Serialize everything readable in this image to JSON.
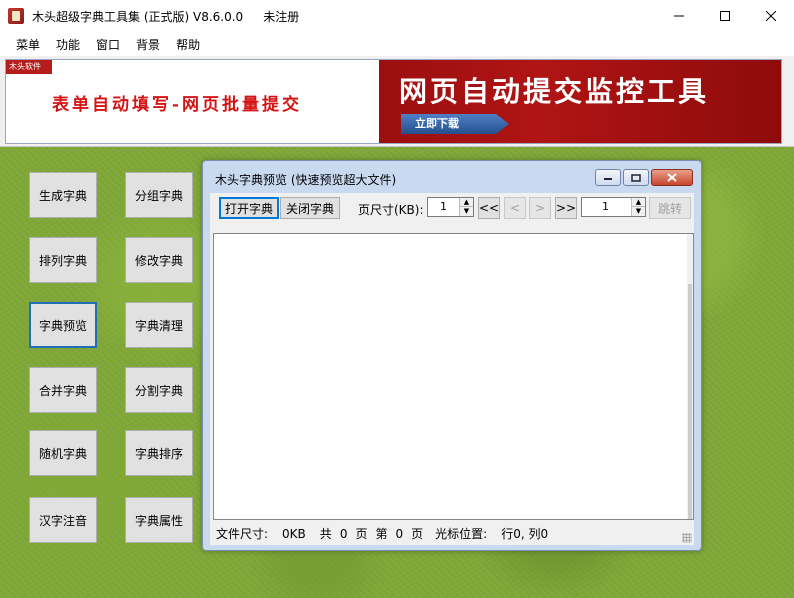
{
  "window": {
    "title": "木头超级字典工具集 (正式版) V8.6.0.0",
    "registration": "未注册",
    "minimize_icon": "minimize-icon",
    "maximize_icon": "maximize-icon",
    "close_icon": "close-icon"
  },
  "menu": [
    "菜单",
    "功能",
    "窗口",
    "背景",
    "帮助"
  ],
  "banner": {
    "logo_text": "木头软件",
    "left_text": "表单自动填写-网页批量提交",
    "right_title": "网页自动提交监控工具",
    "download_label": "立即下载"
  },
  "sidebar": {
    "buttons": [
      "生成字典",
      "分组字典",
      "排列字典",
      "修改字典",
      "字典预览",
      "字典清理",
      "合并字典",
      "分割字典",
      "随机字典",
      "字典排序",
      "汉字注音",
      "字典属性"
    ],
    "focused": "字典预览"
  },
  "preview": {
    "title": "木头字典预览 (快速预览超大文件)",
    "open_btn": "打开字典",
    "close_btn": "关闭字典",
    "page_size_label": "页尺寸(KB):",
    "page_size_value": "1",
    "nav_first": "<<",
    "nav_prev": "<",
    "nav_next": ">",
    "nav_last": ">>",
    "page_value": "1",
    "jump_btn": "跳转",
    "status": {
      "file_size_label": "文件尺寸:",
      "file_size_value": "0KB",
      "total_label": "共",
      "total_value": "0",
      "page_unit": "页",
      "current_label": "第",
      "current_value": "0",
      "page_unit2": "页",
      "cursor_label": "光标位置:",
      "cursor_value": "行0, 列0"
    }
  },
  "colors": {
    "banner_red": "#b01414",
    "focus_blue": "#1e6fb8",
    "grass": "#7fa838"
  }
}
